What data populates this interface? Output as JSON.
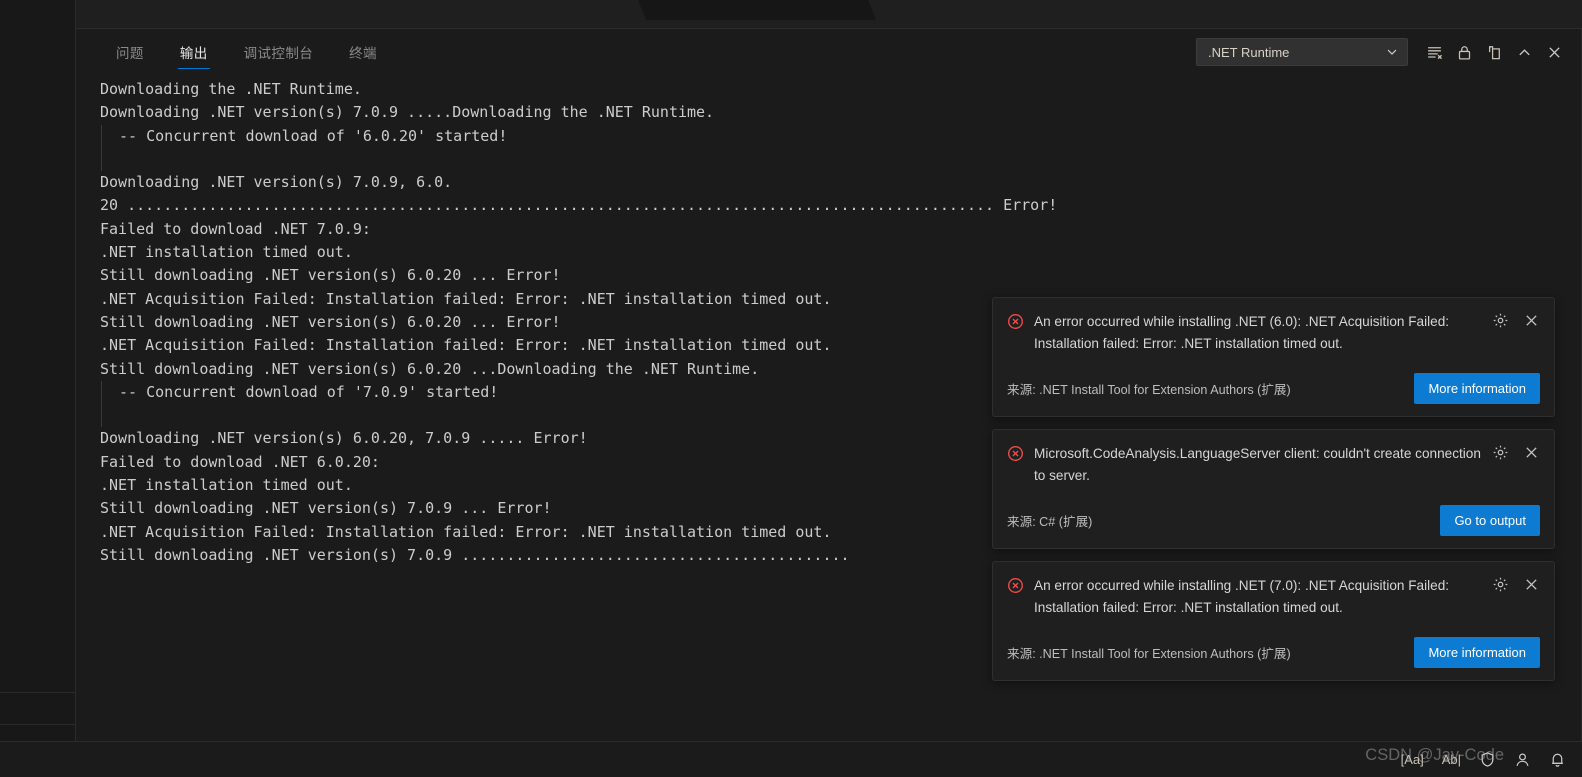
{
  "window": {
    "background_color": "#1b1b1b",
    "accent_color": "#0078d4"
  },
  "panel": {
    "tabs": [
      {
        "label": "问题",
        "active": false
      },
      {
        "label": "输出",
        "active": true
      },
      {
        "label": "调试控制台",
        "active": false
      },
      {
        "label": "终端",
        "active": false
      }
    ],
    "channel_select": {
      "value": ".NET Runtime",
      "icon": "chevron-down-icon"
    },
    "actions": [
      {
        "name": "clear-output-button",
        "icon": "clear-output-icon",
        "title": "清除输出"
      },
      {
        "name": "lock-scroll-button",
        "icon": "lock-icon",
        "title": "锁定滚动"
      },
      {
        "name": "open-in-editor-button",
        "icon": "split-editor-icon",
        "title": "在编辑器中打开"
      },
      {
        "name": "maximize-panel-button",
        "icon": "chevron-up-icon",
        "title": "最大化面板"
      },
      {
        "name": "close-panel-button",
        "icon": "close-icon",
        "title": "关闭面板"
      }
    ]
  },
  "output": {
    "channel": ".NET Runtime",
    "lines": [
      "Downloading the .NET Runtime.",
      "Downloading .NET version(s) 7.0.9 .....Downloading the .NET Runtime.",
      " -- Concurrent download of '6.0.20' started!",
      "",
      "",
      "Downloading .NET version(s) 7.0.9, 6.0.",
      "20 ................................................................................................ Error!",
      "Failed to download .NET 7.0.9:",
      ".NET installation timed out.",
      "",
      "Still downloading .NET version(s) 6.0.20 ... Error!",
      ".NET Acquisition Failed: Installation failed: Error: .NET installation timed out.",
      "",
      "Still downloading .NET version(s) 6.0.20 ... Error!",
      ".NET Acquisition Failed: Installation failed: Error: .NET installation timed out.",
      "",
      "Still downloading .NET version(s) 6.0.20 ...Downloading the .NET Runtime.",
      " -- Concurrent download of '7.0.9' started!",
      "",
      "",
      "Downloading .NET version(s) 6.0.20, 7.0.9 ..... Error!",
      "Failed to download .NET 6.0.20:",
      ".NET installation timed out.",
      "",
      "Still downloading .NET version(s) 7.0.9 ... Error!",
      ".NET Acquisition Failed: Installation failed: Error: .NET installation timed out.",
      "",
      "Still downloading .NET version(s) 7.0.9 ..........................................."
    ]
  },
  "notifications": [
    {
      "severity": "error",
      "icon": "error-circle-icon",
      "message": "An error occurred while installing .NET (6.0): .NET Acquisition Failed: Installation failed: Error: .NET installation timed out.",
      "source": "来源: .NET Install Tool for Extension Authors (扩展)",
      "button": "More information",
      "gear_icon": "gear-icon",
      "close_icon": "close-icon"
    },
    {
      "severity": "error",
      "icon": "error-circle-icon",
      "message": "Microsoft.CodeAnalysis.LanguageServer client: couldn't create connection to server.",
      "source": "来源: C# (扩展)",
      "button": "Go to output",
      "gear_icon": "gear-icon",
      "close_icon": "close-icon"
    },
    {
      "severity": "error",
      "icon": "error-circle-icon",
      "message": "An error occurred while installing .NET (7.0): .NET Acquisition Failed: Installation failed: Error: .NET installation timed out.",
      "source": "来源: .NET Install Tool for Extension Authors (扩展)",
      "button": "More information",
      "gear_icon": "gear-icon",
      "close_icon": "close-icon"
    }
  ],
  "statusbar": {
    "items": [
      {
        "name": "screencast-mode-indicator",
        "label": "[Aa]"
      },
      {
        "name": "text-cursor-indicator",
        "label": "Ab|"
      }
    ],
    "icons": [
      {
        "name": "shield-icon"
      },
      {
        "name": "account-icon"
      },
      {
        "name": "bell-icon"
      }
    ]
  },
  "watermark": {
    "text": "CSDN @Jay-Code"
  }
}
